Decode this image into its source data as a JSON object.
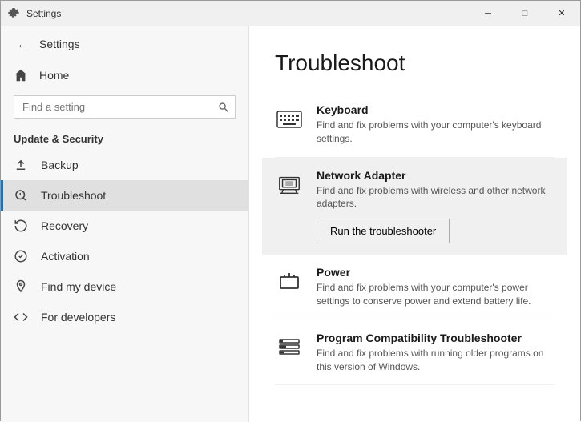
{
  "titlebar": {
    "title": "Settings",
    "minimize_label": "─",
    "maximize_label": "□",
    "close_label": "✕"
  },
  "sidebar": {
    "back_icon": "←",
    "app_title": "Settings",
    "home_label": "Home",
    "search_placeholder": "Find a setting",
    "search_icon": "🔍",
    "section_title": "Update & Security",
    "items": [
      {
        "label": "Backup",
        "icon": "backup"
      },
      {
        "label": "Troubleshoot",
        "icon": "troubleshoot",
        "active": true
      },
      {
        "label": "Recovery",
        "icon": "recovery"
      },
      {
        "label": "Activation",
        "icon": "activation"
      },
      {
        "label": "Find my device",
        "icon": "find-device"
      },
      {
        "label": "For developers",
        "icon": "developers"
      }
    ]
  },
  "content": {
    "page_title": "Troubleshoot",
    "items": [
      {
        "name": "Keyboard",
        "desc": "Find and fix problems with your computer's keyboard settings.",
        "icon": "keyboard",
        "highlighted": false,
        "has_button": false
      },
      {
        "name": "Network Adapter",
        "desc": "Find and fix problems with wireless and other network adapters.",
        "icon": "network",
        "highlighted": true,
        "has_button": true,
        "button_label": "Run the troubleshooter"
      },
      {
        "name": "Power",
        "desc": "Find and fix problems with your computer's power settings to conserve power and extend battery life.",
        "icon": "power",
        "highlighted": false,
        "has_button": false
      },
      {
        "name": "Program Compatibility Troubleshooter",
        "desc": "Find and fix problems with running older programs on this version of Windows.",
        "icon": "program-compat",
        "highlighted": false,
        "has_button": false
      }
    ]
  }
}
